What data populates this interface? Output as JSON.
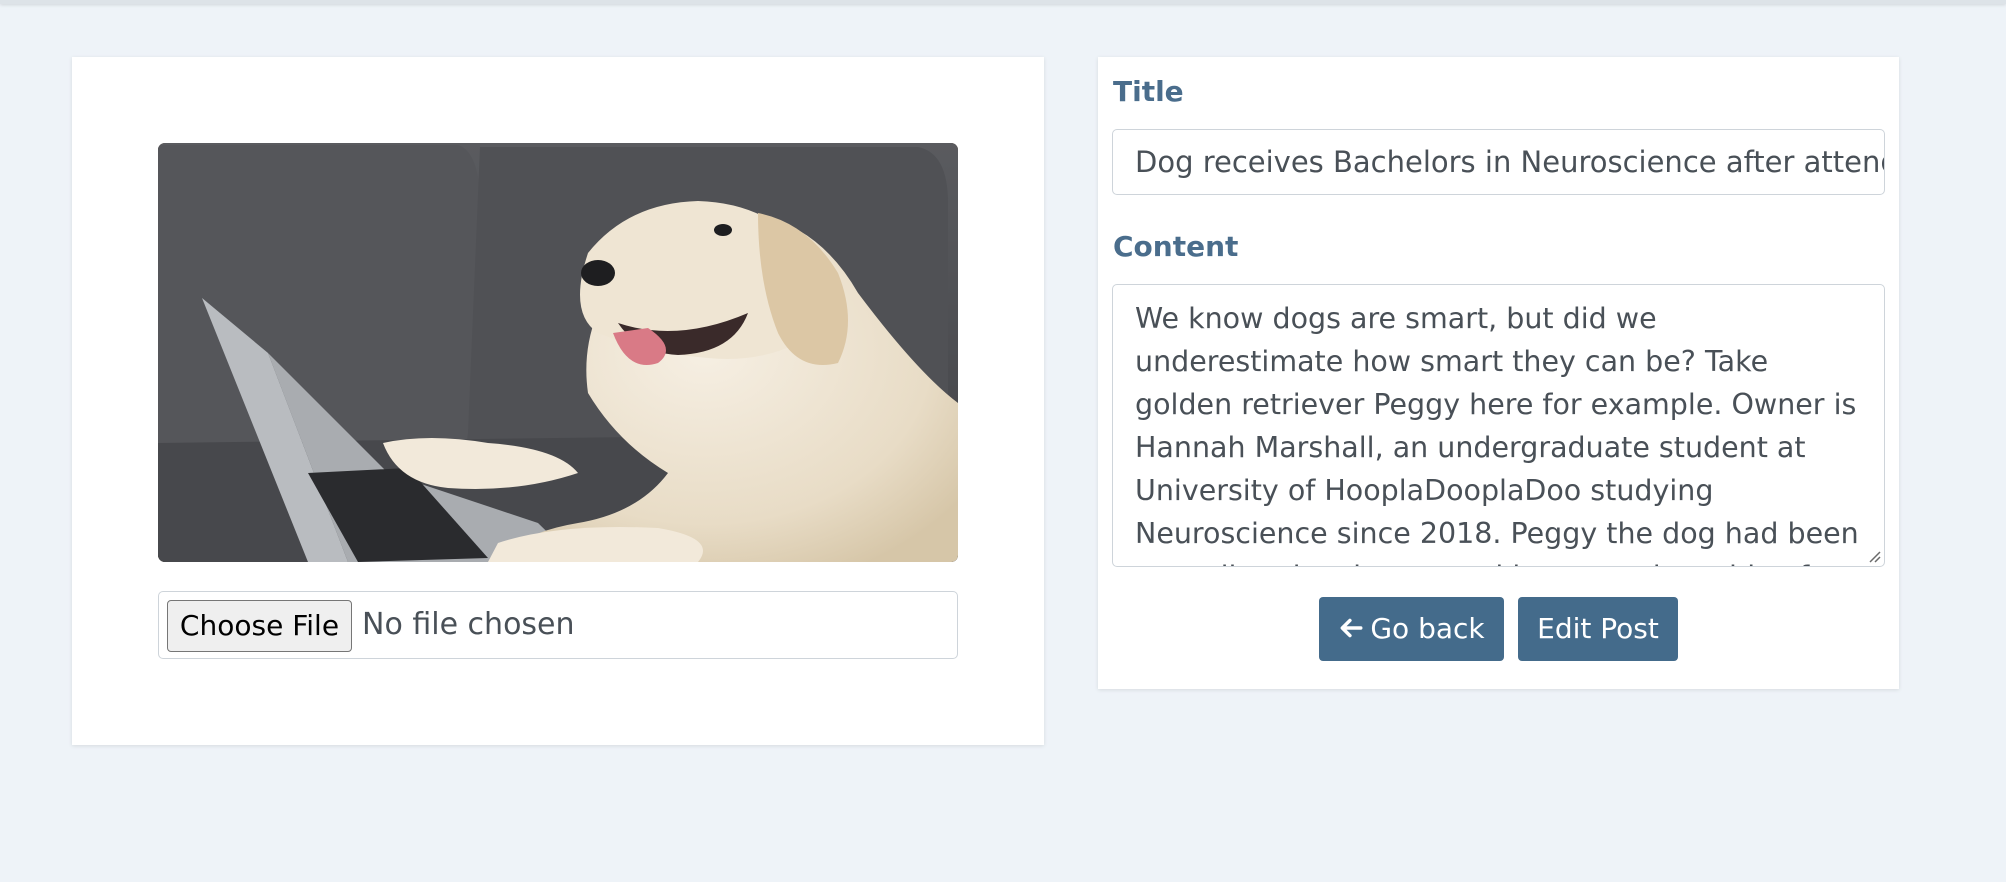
{
  "image_panel": {
    "file_button_label": "Choose File",
    "file_status": "No file chosen"
  },
  "form": {
    "title_label": "Title",
    "title_value": "Dog receives Bachelors in Neuroscience after attending",
    "content_label": "Content",
    "content_value": "We know dogs are smart, but did we underestimate how smart they can be? Take golden retriever Peggy here for example. Owner is Hannah Marshall, an undergraduate student at University of HooplaDooplaDoo studying Neuroscience since 2018. Peggy the dog had been attending the classes and lectures alongside of Hannah Marshall, in person..."
  },
  "actions": {
    "back_label": "Go back",
    "edit_label": "Edit Post"
  },
  "colors": {
    "background": "#eef3f8",
    "accent": "#446b8b",
    "label": "#4a6d8c"
  }
}
